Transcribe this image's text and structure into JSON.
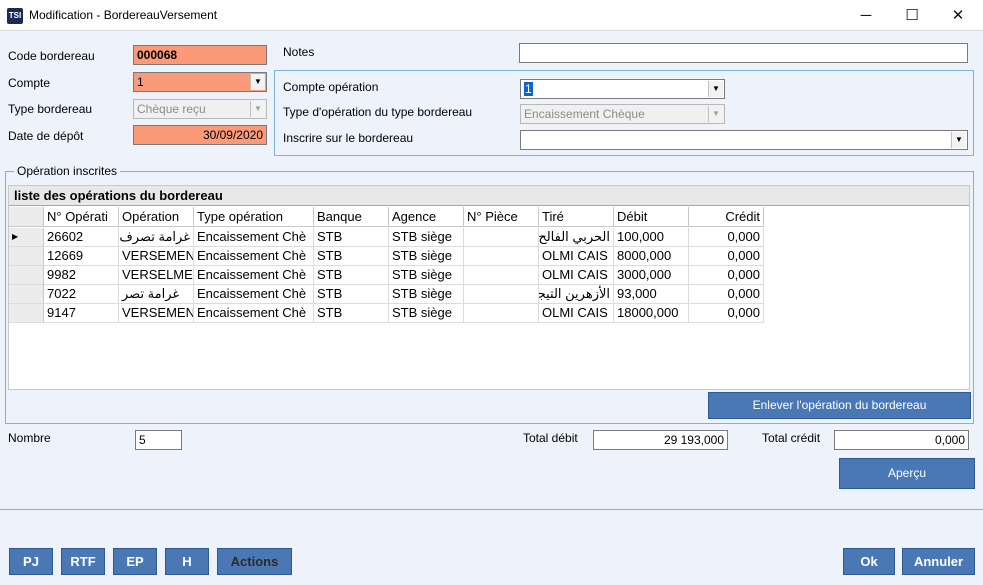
{
  "window": {
    "app_logo": "TSI",
    "title": "Modification - BordereauVersement",
    "minimize": "─",
    "maximize": "☐",
    "close": "✕"
  },
  "form": {
    "code_bordereau": {
      "label": "Code bordereau",
      "value": "000068"
    },
    "compte": {
      "label": "Compte",
      "value": "1"
    },
    "type_bordereau": {
      "label": "Type bordereau",
      "value": "Chèque reçu"
    },
    "date_depot": {
      "label": "Date de dépôt",
      "value": "30/09/2020"
    },
    "notes": {
      "label": "Notes",
      "value": ""
    }
  },
  "operation_group": {
    "compte_operation": {
      "label": "Compte opération",
      "value": "1"
    },
    "type_operation": {
      "label": "Type d'opération du type bordereau",
      "value": "Encaissement Chèque"
    },
    "inscrire": {
      "label": "Inscrire sur le bordereau",
      "value": ""
    }
  },
  "operations": {
    "group_title": "Opération inscrites",
    "caption": "liste des opérations du bordereau",
    "columns": [
      "N° Opérati",
      "Opération",
      "Type opération",
      "Banque",
      "Agence",
      "N° Pièce",
      "Tiré",
      "Débit",
      "Crédit"
    ],
    "rows": [
      {
        "num": "26602",
        "operation": "غرامة تصرف",
        "type": "Encaissement Chè",
        "banque": "STB",
        "agence": "STB siège",
        "piece": "",
        "tire": "الحربي الفالح",
        "debit": "100,000",
        "credit": "0,000",
        "current": true
      },
      {
        "num": "12669",
        "operation": "VERSEMEN",
        "type": "Encaissement Chè",
        "banque": "STB",
        "agence": "STB siège",
        "piece": "",
        "tire": "OLMI CAIS",
        "debit": "8000,000",
        "credit": "0,000",
        "current": false
      },
      {
        "num": "9982",
        "operation": "VERSELME",
        "type": "Encaissement Chè",
        "banque": "STB",
        "agence": "STB siège",
        "piece": "",
        "tire": "OLMI CAIS",
        "debit": "3000,000",
        "credit": "0,000",
        "current": false
      },
      {
        "num": "7022",
        "operation": "غرامة تصر",
        "type": "Encaissement Chè",
        "banque": "STB",
        "agence": "STB siège",
        "piece": "",
        "tire": "الأزهرين التيجا",
        "debit": "93,000",
        "credit": "0,000",
        "current": false
      },
      {
        "num": "9147",
        "operation": "VERSEMEN",
        "type": "Encaissement Chè",
        "banque": "STB",
        "agence": "STB siège",
        "piece": "",
        "tire": "OLMI CAIS",
        "debit": "18000,000",
        "credit": "0,000",
        "current": false
      }
    ],
    "remove_button": "Enlever l'opération du bordereau"
  },
  "totals": {
    "nombre": {
      "label": "Nombre",
      "value": "5"
    },
    "total_debit": {
      "label": "Total débit",
      "value": "29 193,000"
    },
    "total_credit": {
      "label": "Total crédit",
      "value": "0,000"
    },
    "apercu_button": "Aperçu"
  },
  "bottom_buttons": {
    "pj": "PJ",
    "rtf": "RTF",
    "ep": "EP",
    "h": "H",
    "actions": "Actions",
    "ok": "Ok",
    "annuler": "Annuler"
  },
  "colors": {
    "required_field": "#fa9a78",
    "button": "#4a78b4",
    "border": "#7ab4e0"
  }
}
